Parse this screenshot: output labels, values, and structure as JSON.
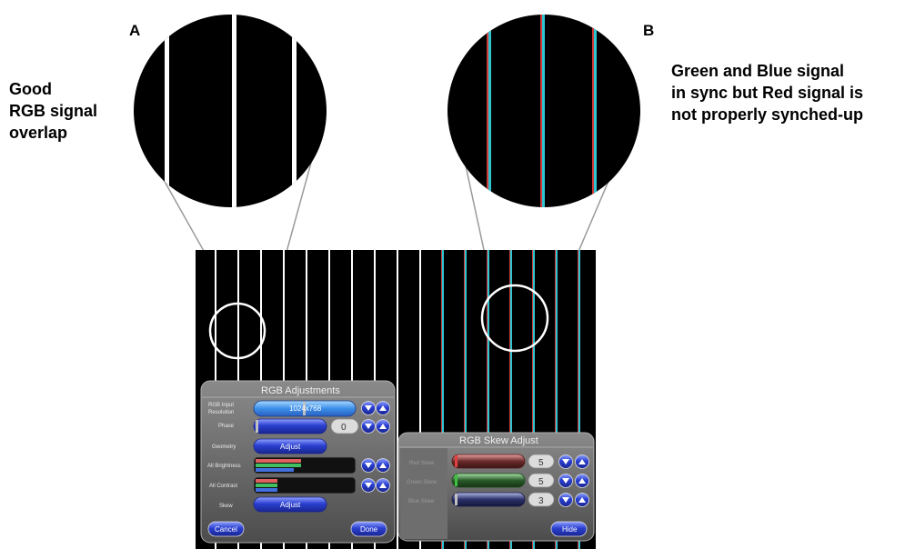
{
  "panel_a": {
    "letter": "A",
    "caption_lines": [
      "Good",
      "RGB signal",
      "overlap"
    ]
  },
  "panel_b": {
    "letter": "B",
    "caption_lines": [
      "Green and Blue signal",
      "in sync but Red signal is",
      "not properly synched-up"
    ]
  },
  "rgb_adjustments": {
    "title": "RGB Adjustments",
    "rows": [
      {
        "label_lines": [
          "RGB Input",
          "Resolution"
        ],
        "value": "1024x768"
      },
      {
        "label_lines": [
          "Phase"
        ],
        "value": "0"
      },
      {
        "label_lines": [
          "Geometry"
        ],
        "button": "Adjust"
      },
      {
        "label_lines": [
          "All Brightness"
        ]
      },
      {
        "label_lines": [
          "All Contrast"
        ]
      },
      {
        "label_lines": [
          "Skew"
        ],
        "button": "Adjust"
      }
    ],
    "cancel_label": "Cancel",
    "done_label": "Done"
  },
  "rgb_skew_adjust": {
    "title": "RGB Skew Adjust",
    "rows": [
      {
        "label": "Red Skew",
        "value": "5",
        "color": "#c03030"
      },
      {
        "label": "Green Skew",
        "value": "5",
        "color": "#2f9a3a"
      },
      {
        "label": "Blue Skew",
        "value": "3",
        "color": "#3a4a9a"
      }
    ],
    "hide_label": "Hide"
  },
  "colors": {
    "red_line": "#d23a3a",
    "cyan_line": "#2ec4d0",
    "button_blue": "#2a3fd0"
  }
}
